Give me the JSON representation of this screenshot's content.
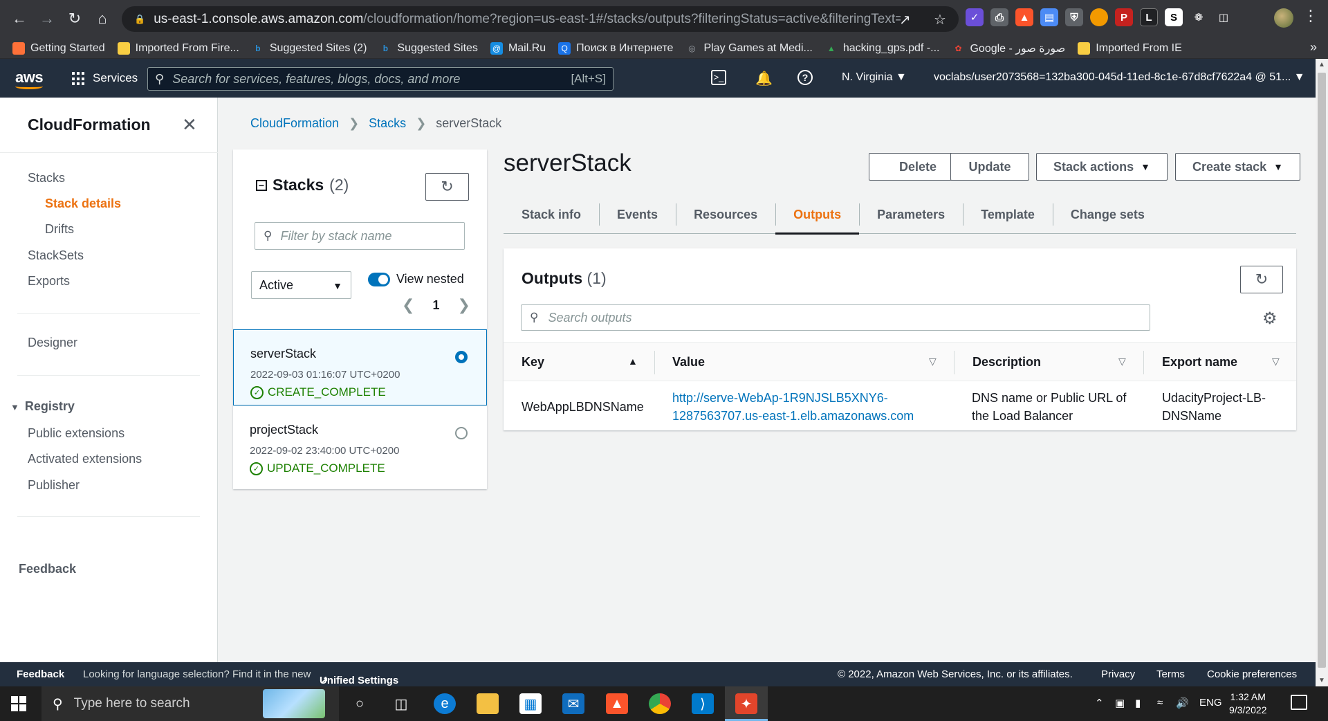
{
  "browser": {
    "url_host": "us-east-1.console.aws.amazon.com",
    "url_path": "/cloudformation/home?region=us-east-1#/stacks/outputs?filteringStatus=active&filteringText=&viewN...",
    "bookmarks": [
      {
        "label": "Getting Started",
        "icon": "firefox-icon",
        "color": "#ff7139"
      },
      {
        "label": "Imported From Fire...",
        "icon": "folder-icon",
        "color": "#f9ce43"
      },
      {
        "label": "Suggested Sites (2)",
        "icon": "bing-icon",
        "color": "#2b8fd6"
      },
      {
        "label": "Suggested Sites",
        "icon": "bing-icon",
        "color": "#2b8fd6"
      },
      {
        "label": "Mail.Ru",
        "icon": "mailru-icon",
        "color": "#168de2"
      },
      {
        "label": "Поиск в Интернете",
        "icon": "search-icon",
        "color": "#1a73e8"
      },
      {
        "label": "Play Games at Medi...",
        "icon": "globe-icon",
        "color": "#9aa0a6"
      },
      {
        "label": "hacking_gps.pdf -...",
        "icon": "drive-icon",
        "color": "#34a853"
      },
      {
        "label": "Google - صورة صور",
        "icon": "photos-icon",
        "color": "#ea4335"
      },
      {
        "label": "Imported From IE",
        "icon": "folder-icon",
        "color": "#f9ce43"
      }
    ]
  },
  "awsnav": {
    "services_label": "Services",
    "search_placeholder": "Search for services, features, blogs, docs, and more",
    "search_shortcut": "[Alt+S]",
    "region": "N. Virginia ▼",
    "account": "voclabs/user2073568=132ba300-045d-11ed-8c1e-67d8cf7622a4 @ 51... ▼"
  },
  "sidebar": {
    "title": "CloudFormation",
    "items": {
      "stacks": "Stacks",
      "stack_details": "Stack details",
      "drifts": "Drifts",
      "stacksets": "StackSets",
      "exports": "Exports",
      "designer": "Designer",
      "registry": "Registry",
      "public_extensions": "Public extensions",
      "activated_extensions": "Activated extensions",
      "publisher": "Publisher",
      "feedback": "Feedback"
    }
  },
  "breadcrumb": {
    "root": "CloudFormation",
    "stacks": "Stacks",
    "current": "serverStack"
  },
  "stacks_panel": {
    "title": "Stacks",
    "count": "(2)",
    "filter_placeholder": "Filter by stack name",
    "status_filter": "Active",
    "view_nested_label": "View nested",
    "view_nested_on": true,
    "page": "1",
    "stacks": [
      {
        "name": "serverStack",
        "timestamp": "2022-09-03 01:16:07 UTC+0200",
        "status": "CREATE_COMPLETE",
        "selected": true
      },
      {
        "name": "projectStack",
        "timestamp": "2022-09-02 23:40:00 UTC+0200",
        "status": "UPDATE_COMPLETE",
        "selected": false
      }
    ]
  },
  "detail": {
    "title": "serverStack",
    "buttons": {
      "delete": "Delete",
      "update": "Update",
      "stack_actions": "Stack actions",
      "create_stack": "Create stack"
    },
    "tabs": [
      "Stack info",
      "Events",
      "Resources",
      "Outputs",
      "Parameters",
      "Template",
      "Change sets"
    ],
    "active_tab": "Outputs"
  },
  "outputs": {
    "title": "Outputs",
    "count": "(1)",
    "search_placeholder": "Search outputs",
    "columns": {
      "key": "Key",
      "value": "Value",
      "description": "Description",
      "export_name": "Export name"
    },
    "rows": [
      {
        "key": "WebAppLBDNSName",
        "value_line1": "http://serve-WebAp-1R9NJSLB5XNY6-",
        "value_line2": "1287563707.us-east-1.elb.amazonaws.com",
        "description_line1": "DNS name or Public URL of",
        "description_line2": "the Load Balancer",
        "export_line1": "UdacityProject-LB-",
        "export_line2": "DNSName"
      }
    ]
  },
  "footer": {
    "feedback": "Feedback",
    "language_note": "Looking for language selection? Find it in the new",
    "unified_settings": "Unified Settings",
    "copyright": "© 2022, Amazon Web Services, Inc. or its affiliates.",
    "privacy": "Privacy",
    "terms": "Terms",
    "cookie": "Cookie preferences"
  },
  "taskbar": {
    "search_placeholder": "Type here to search",
    "language": "ENG",
    "time": "1:32 AM",
    "date": "9/3/2022"
  },
  "colors": {
    "aws_orange": "#ec7211",
    "aws_blue": "#0073bb",
    "aws_navy": "#232f3e",
    "success_green": "#1d8102"
  }
}
